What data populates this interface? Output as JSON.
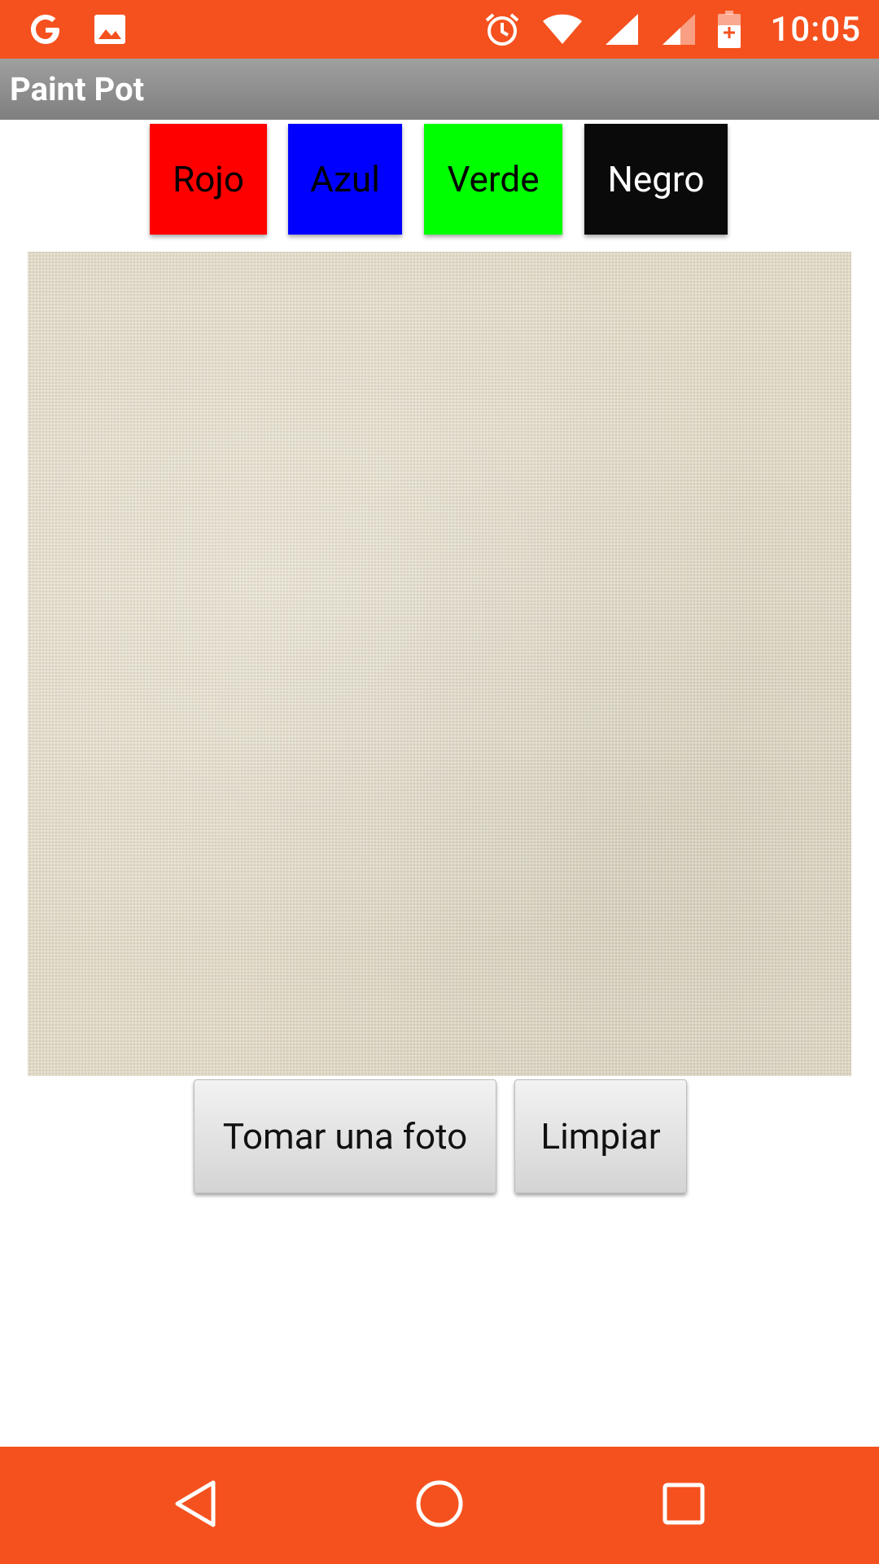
{
  "status_bar": {
    "time": "10:05",
    "icons": [
      "google-icon",
      "image-icon",
      "alarm-icon",
      "wifi-icon",
      "signal-icon",
      "signal-weak-icon",
      "battery-charging-icon"
    ],
    "background": "#f5511e"
  },
  "app": {
    "title": "Paint Pot",
    "title_bar_color": "#8f8f8f"
  },
  "color_buttons": [
    {
      "label": "Rojo",
      "color": "#ff0000"
    },
    {
      "label": "Azul",
      "color": "#0000ff"
    },
    {
      "label": "Verde",
      "color": "#00ff00"
    },
    {
      "label": "Negro",
      "color": "#0a0a0a"
    }
  ],
  "canvas": {
    "background": "linen-texture"
  },
  "actions": {
    "take_photo": "Tomar una foto",
    "clear": "Limpiar"
  },
  "nav_bar": {
    "buttons": [
      "back-icon",
      "home-icon",
      "recents-icon"
    ],
    "background": "#f5511e"
  }
}
